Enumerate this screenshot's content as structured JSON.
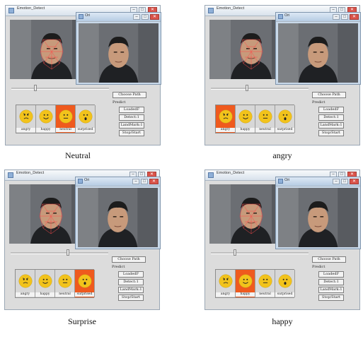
{
  "panels": [
    {
      "caption": "Neutral",
      "window_title": "Emotion_Detect",
      "popup_title": "Ori",
      "choose_path": "Choose Path",
      "predict_label": "Predict",
      "buttons": [
        "LoadedF",
        "Detect:1",
        "LandMark:1",
        "Stop/Start"
      ],
      "emotions": [
        {
          "label": "angry",
          "face": "angry"
        },
        {
          "label": "happy",
          "face": "happy"
        },
        {
          "label": "neutral",
          "face": "neutral"
        },
        {
          "label": "surprised",
          "face": "surprised"
        }
      ],
      "active_emotion": "neutral"
    },
    {
      "caption": "angry",
      "window_title": "Emotion_Detect",
      "popup_title": "Ori",
      "choose_path": "Choose Path",
      "predict_label": "Predict",
      "buttons": [
        "LoadedF",
        "Detect:1",
        "LandMark:1",
        "Stop/Start"
      ],
      "emotions": [
        {
          "label": "angry",
          "face": "angry"
        },
        {
          "label": "happy",
          "face": "happy"
        },
        {
          "label": "neutral",
          "face": "neutral"
        },
        {
          "label": "surprised",
          "face": "surprised"
        }
      ],
      "active_emotion": "angry"
    },
    {
      "caption": "Surprise",
      "window_title": "Emotion_Detect",
      "popup_title": "Ori",
      "choose_path": "Choose Path",
      "predict_label": "Predict",
      "buttons": [
        "LoadedF",
        "Detect:1",
        "LandMark:1",
        "Stop/Start"
      ],
      "emotions": [
        {
          "label": "angry",
          "face": "angry"
        },
        {
          "label": "happy",
          "face": "happy"
        },
        {
          "label": "neutral",
          "face": "neutral"
        },
        {
          "label": "surprised",
          "face": "surprised"
        }
      ],
      "active_emotion": "surprised"
    },
    {
      "caption": "happy",
      "window_title": "Emotion_Detect",
      "popup_title": "Ori",
      "choose_path": "Choose Path",
      "predict_label": "Predict",
      "buttons": [
        "LoadedF",
        "Detect:1",
        "LandMark:1",
        "Stop/Start"
      ],
      "emotions": [
        {
          "label": "angry",
          "face": "angry"
        },
        {
          "label": "happy",
          "face": "happy"
        },
        {
          "label": "neutral",
          "face": "neutral"
        },
        {
          "label": "surprised",
          "face": "surprised"
        }
      ],
      "active_emotion": "happy"
    }
  ],
  "colors": {
    "active_emotion": "#ef5a1e",
    "emoji_face": "#f2c31b",
    "landmark_mesh": "#ff4a4a"
  }
}
